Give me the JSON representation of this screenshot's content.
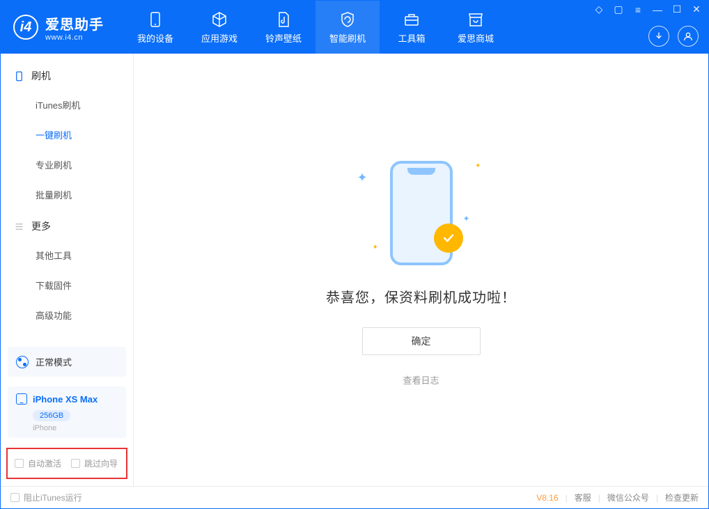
{
  "app": {
    "title": "爱思助手",
    "subtitle": "www.i4.cn"
  },
  "nav": {
    "tabs": [
      {
        "label": "我的设备"
      },
      {
        "label": "应用游戏"
      },
      {
        "label": "铃声壁纸"
      },
      {
        "label": "智能刷机"
      },
      {
        "label": "工具箱"
      },
      {
        "label": "爱思商城"
      }
    ],
    "active_index": 3
  },
  "sidebar": {
    "group1": {
      "title": "刷机",
      "items": [
        {
          "label": "iTunes刷机"
        },
        {
          "label": "一键刷机"
        },
        {
          "label": "专业刷机"
        },
        {
          "label": "批量刷机"
        }
      ],
      "active_index": 1
    },
    "group2": {
      "title": "更多",
      "items": [
        {
          "label": "其他工具"
        },
        {
          "label": "下载固件"
        },
        {
          "label": "高级功能"
        }
      ]
    },
    "mode": {
      "label": "正常模式"
    },
    "device": {
      "name": "iPhone XS Max",
      "storage": "256GB",
      "type": "iPhone"
    },
    "options": {
      "auto_activate": "自动激活",
      "skip_guide": "跳过向导"
    }
  },
  "main": {
    "success_title": "恭喜您，保资料刷机成功啦！",
    "confirm": "确定",
    "view_log": "查看日志"
  },
  "footer": {
    "block_itunes": "阻止iTunes运行",
    "version": "V8.16",
    "links": [
      "客服",
      "微信公众号",
      "检查更新"
    ]
  }
}
